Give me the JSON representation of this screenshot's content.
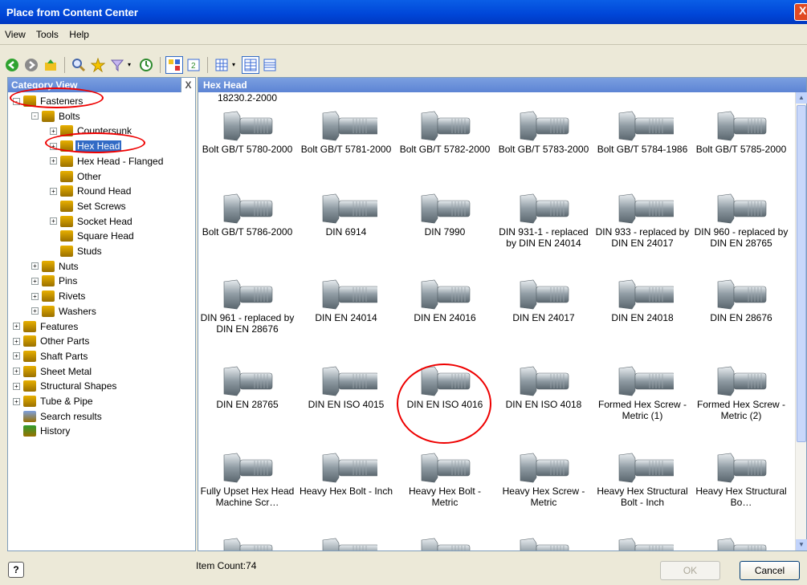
{
  "window": {
    "title": "Place from Content Center",
    "close_glyph": "X"
  },
  "menu": [
    "View",
    "Tools",
    "Help"
  ],
  "toolbar": {
    "icons": [
      "back-icon",
      "forward-icon",
      "up-icon",
      "search-icon",
      "favorites-icon",
      "filter-icon",
      "history-icon",
      "tree-view-icon",
      "refresh-icon",
      "views-icon",
      "table-view-icon",
      "detail-view-icon"
    ]
  },
  "left_panel": {
    "header": "Category View",
    "close_label": "X",
    "tree": [
      {
        "label": "Fasteners",
        "level": 0,
        "expander": "-",
        "icon_color": "#e8b000"
      },
      {
        "label": "Bolts",
        "level": 1,
        "expander": "-",
        "icon_color": "#e8b000"
      },
      {
        "label": "Countersunk",
        "level": 2,
        "expander": "+",
        "icon_color": "#e8b000"
      },
      {
        "label": "Hex Head",
        "level": 2,
        "expander": "+",
        "icon_color": "#e8b000",
        "selected": true
      },
      {
        "label": "Hex Head - Flanged",
        "level": 2,
        "expander": "+",
        "icon_color": "#e8b000"
      },
      {
        "label": "Other",
        "level": 2,
        "expander": "",
        "icon_color": "#e8b000"
      },
      {
        "label": "Round Head",
        "level": 2,
        "expander": "+",
        "icon_color": "#e8b000"
      },
      {
        "label": "Set Screws",
        "level": 2,
        "expander": "",
        "icon_color": "#e8b000"
      },
      {
        "label": "Socket Head",
        "level": 2,
        "expander": "+",
        "icon_color": "#e8b000"
      },
      {
        "label": "Square Head",
        "level": 2,
        "expander": "",
        "icon_color": "#e8b000"
      },
      {
        "label": "Studs",
        "level": 2,
        "expander": "",
        "icon_color": "#e8b000"
      },
      {
        "label": "Nuts",
        "level": 1,
        "expander": "+",
        "icon_color": "#e8b000"
      },
      {
        "label": "Pins",
        "level": 1,
        "expander": "+",
        "icon_color": "#e8b000"
      },
      {
        "label": "Rivets",
        "level": 1,
        "expander": "+",
        "icon_color": "#e8b000"
      },
      {
        "label": "Washers",
        "level": 1,
        "expander": "+",
        "icon_color": "#e8b000"
      },
      {
        "label": "Features",
        "level": 0,
        "expander": "+",
        "icon_color": "#e8b000"
      },
      {
        "label": "Other Parts",
        "level": 0,
        "expander": "+",
        "icon_color": "#e8b000"
      },
      {
        "label": "Shaft Parts",
        "level": 0,
        "expander": "+",
        "icon_color": "#e8b000"
      },
      {
        "label": "Sheet Metal",
        "level": 0,
        "expander": "+",
        "icon_color": "#e8b000"
      },
      {
        "label": "Structural Shapes",
        "level": 0,
        "expander": "+",
        "icon_color": "#e8b000"
      },
      {
        "label": "Tube & Pipe",
        "level": 0,
        "expander": "+",
        "icon_color": "#e8b000"
      },
      {
        "label": "Search results",
        "level": 0,
        "expander": "",
        "icon_color": "#7da0e0"
      },
      {
        "label": "History",
        "level": 0,
        "expander": "",
        "icon_color": "#2e9c2e"
      }
    ]
  },
  "right_panel": {
    "header": "Hex Head",
    "top_partial": "18230.2-2000",
    "items": [
      "Bolt GB/T 5780-2000",
      "Bolt GB/T 5781-2000",
      "Bolt GB/T 5782-2000",
      "Bolt GB/T 5783-2000",
      "Bolt GB/T 5784-1986",
      "Bolt GB/T 5785-2000",
      "Bolt GB/T 5786-2000",
      "DIN 6914",
      "DIN 7990",
      "DIN 931-1 - replaced by DIN EN 24014",
      "DIN 933 - replaced by DIN EN 24017",
      "DIN 960 - replaced by DIN EN 28765",
      "DIN 961 - replaced by DIN EN 28676",
      "DIN EN 24014",
      "DIN EN 24016",
      "DIN EN 24017",
      "DIN EN 24018",
      "DIN EN 28676",
      "DIN EN 28765",
      "DIN EN ISO 4015",
      "DIN EN ISO 4016",
      "DIN EN ISO 4018",
      "Formed Hex Screw - Metric (1)",
      "Formed Hex Screw - Metric (2)",
      "Fully Upset Hex Head Machine Scr…",
      "Heavy Hex Bolt - Inch",
      "Heavy Hex Bolt - Metric",
      "Heavy Hex Screw - Metric",
      "Heavy Hex Structural Bolt - Inch",
      "Heavy Hex Structural Bo…",
      "",
      "",
      "",
      "",
      "",
      ""
    ]
  },
  "status": {
    "item_count": "Item Count:74",
    "help_label": "?"
  },
  "buttons": {
    "ok": "OK",
    "cancel": "Cancel"
  }
}
